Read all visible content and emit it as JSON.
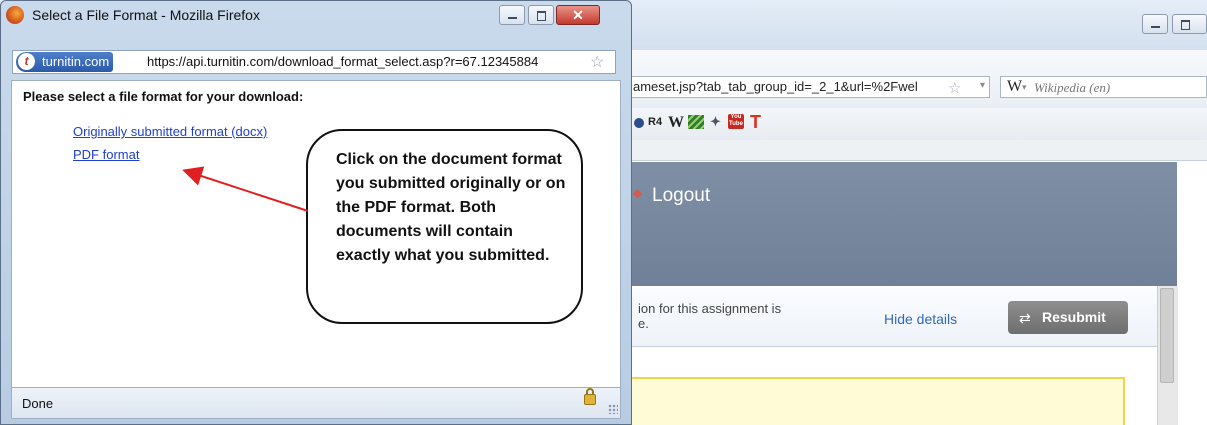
{
  "background_window": {
    "url_partial": "ameset.jsp?tab_tab_group_id=_2_1&url=%2Fwel",
    "search_engine_letter": "W",
    "search_placeholder": "Wikipedia (en)",
    "bookmarks": [
      "R4",
      "W",
      "T"
    ],
    "youtube_label": "You Tube",
    "logout_label": "Logout",
    "info_text": "ion for this assignment is\ne.",
    "hide_details_label": "Hide details",
    "resubmit_label": "Resubmit"
  },
  "popup": {
    "title": "Select a File Format - Mozilla Firefox",
    "site_badge": "turnitin.com",
    "url": "https://api.turnitin.com/download_format_select.asp?r=67.12345884",
    "prompt": "Please select a file format for your download:",
    "links": {
      "docx": "Originally submitted format (docx)",
      "pdf": "PDF format"
    },
    "status": "Done"
  },
  "callout": {
    "text": "Click on the document format you submitted originally or on the PDF format. Both documents will contain exactly what you submitted."
  },
  "colors": {
    "link": "#1f3fd0",
    "arrow": "#e02020",
    "banner": "#7f8fa5",
    "resubmit_bg": "#7e7e7e"
  }
}
